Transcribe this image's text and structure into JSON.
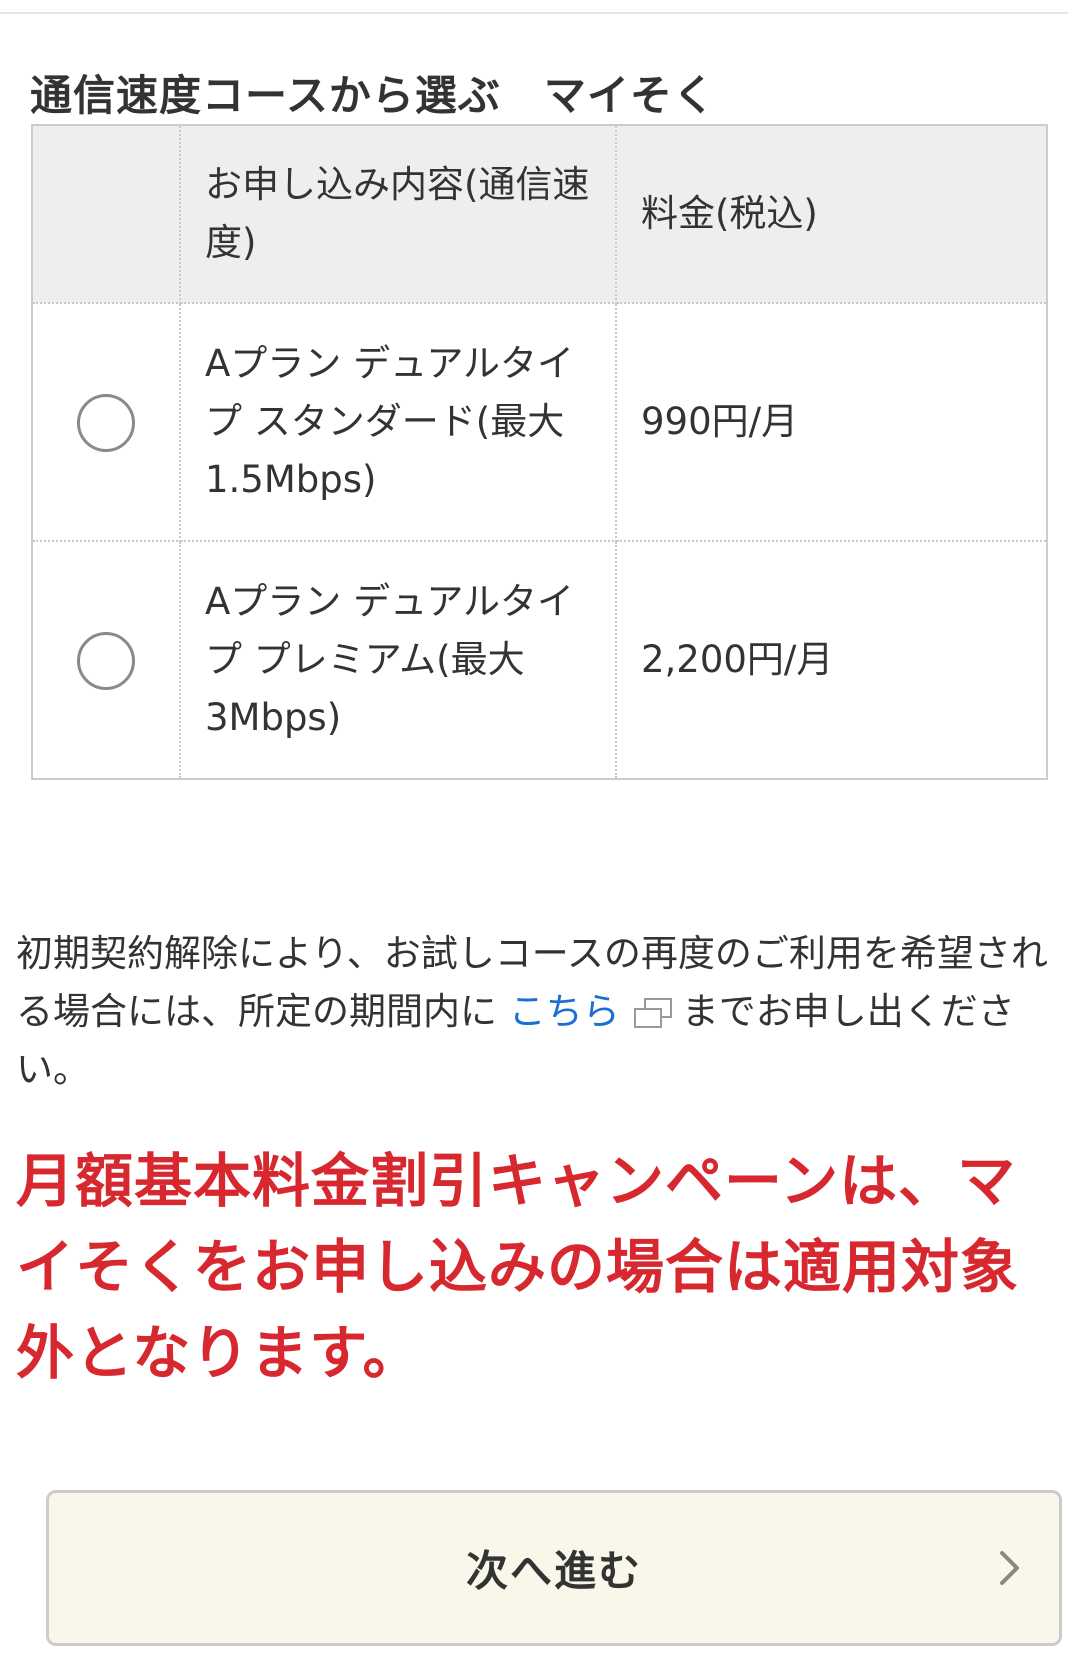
{
  "section": {
    "title": "通信速度コースから選ぶ　マイそく"
  },
  "table": {
    "headers": [
      "",
      "お申し込み内容(通信速度)",
      "料金(税込)"
    ],
    "rows": [
      {
        "plan": "Aプラン デュアルタイプ スタンダード(最大1.5Mbps)",
        "price": "990円/月",
        "selected": false
      },
      {
        "plan": "Aプラン デュアルタイプ プレミアム(最大3Mbps)",
        "price": "2,200円/月",
        "selected": false
      }
    ]
  },
  "notice": {
    "before": "初期契約解除により、お試しコースの再度のご利用を希望される場合には、所定の期間内に ",
    "link": "こちら",
    "after": "までお申し出ください。"
  },
  "warning": "月額基本料金割引キャンペーンは、マイそくをお申し込みの場合は適用対象外となります。",
  "next_button": {
    "label": "次へ進む"
  },
  "colors": {
    "accent_red": "#d7282f",
    "link_blue": "#1a6fd1",
    "button_bg": "#f8f7ea",
    "header_bg": "#eeeeee"
  }
}
